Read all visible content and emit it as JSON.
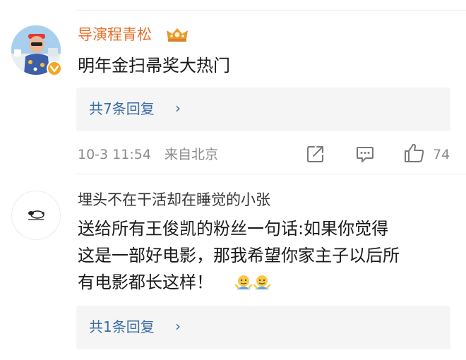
{
  "comments": [
    {
      "username": "导演程青松",
      "username_color": "#e8702a",
      "text": "明年金扫帚奖大热门",
      "reply_label": "共7条回复",
      "time": "10-3 11:54",
      "source": "来自北京",
      "likes": "74",
      "verified_badge": "verified-v-icon",
      "level_badge": "crown-badge-icon"
    },
    {
      "username": "埋头不在干活却在睡觉的小张",
      "username_color": "#333333",
      "text_lines": [
        "送给所有王俊凯的粉丝一句话:如果你觉得",
        "这是一部好电影，那我希望你家主子以后所",
        "有电影都长这样！"
      ],
      "emojis": [
        "shrug-emoji-icon",
        "shrug-emoji-icon"
      ],
      "reply_label": "共1条回复"
    }
  ],
  "colors": {
    "link_blue": "#3b6ea5",
    "meta_gray": "#8a8a8a",
    "reply_bg": "#f5f5f5"
  }
}
